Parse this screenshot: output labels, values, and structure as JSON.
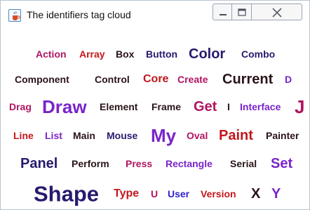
{
  "window": {
    "title": "The identifiers tag cloud"
  },
  "icons": {
    "app": "java-cup-icon",
    "minimize": "minimize-icon",
    "maximize": "maximize-icon",
    "close": "close-icon"
  },
  "colors": {
    "red": "#c4161c",
    "purple": "#7a24c9",
    "magenta": "#b01560",
    "navy": "#261b6e",
    "dark": "#2a1418",
    "blue": "#2f1fd0"
  },
  "tags": [
    {
      "text": "Action",
      "color": "#b01560",
      "weight": 1
    },
    {
      "text": "Array",
      "color": "#c4161c",
      "weight": 1
    },
    {
      "text": "Box",
      "color": "#2a1418",
      "weight": 1
    },
    {
      "text": "Button",
      "color": "#261b6e",
      "weight": 1
    },
    {
      "text": "Color",
      "color": "#261b6e",
      "weight": 3
    },
    {
      "text": "Combo",
      "color": "#261b6e",
      "weight": 1
    },
    {
      "text": "Component",
      "color": "#2a1418",
      "weight": 1
    },
    {
      "text": "Control",
      "color": "#2a1418",
      "weight": 1
    },
    {
      "text": "Core",
      "color": "#c4161c",
      "weight": 2
    },
    {
      "text": "Create",
      "color": "#b01560",
      "weight": 1
    },
    {
      "text": "Current",
      "color": "#2a1418",
      "weight": 3
    },
    {
      "text": "D",
      "color": "#7a24c9",
      "weight": 1
    },
    {
      "text": "Drag",
      "color": "#b01560",
      "weight": 1
    },
    {
      "text": "Draw",
      "color": "#7a24c9",
      "weight": 4
    },
    {
      "text": "Element",
      "color": "#2a1418",
      "weight": 1
    },
    {
      "text": "Frame",
      "color": "#2a1418",
      "weight": 1
    },
    {
      "text": "Get",
      "color": "#b01560",
      "weight": 3
    },
    {
      "text": "I",
      "color": "#2a1418",
      "weight": 1
    },
    {
      "text": "Interface",
      "color": "#7a24c9",
      "weight": 1
    },
    {
      "text": "J",
      "color": "#b01560",
      "weight": 4
    },
    {
      "text": "Line",
      "color": "#c4161c",
      "weight": 1
    },
    {
      "text": "List",
      "color": "#7a24c9",
      "weight": 1
    },
    {
      "text": "Main",
      "color": "#2a1418",
      "weight": 1
    },
    {
      "text": "Mouse",
      "color": "#261b6e",
      "weight": 1
    },
    {
      "text": "My",
      "color": "#7a24c9",
      "weight": 4
    },
    {
      "text": "Oval",
      "color": "#b01560",
      "weight": 1
    },
    {
      "text": "Paint",
      "color": "#c4161c",
      "weight": 3
    },
    {
      "text": "Painter",
      "color": "#2a1418",
      "weight": 1
    },
    {
      "text": "Panel",
      "color": "#261b6e",
      "weight": 3
    },
    {
      "text": "Perform",
      "color": "#2a1418",
      "weight": 1
    },
    {
      "text": "Press",
      "color": "#b01560",
      "weight": 1
    },
    {
      "text": "Rectangle",
      "color": "#7a24c9",
      "weight": 1
    },
    {
      "text": "Serial",
      "color": "#2a1418",
      "weight": 1
    },
    {
      "text": "Set",
      "color": "#7a24c9",
      "weight": 3
    },
    {
      "text": "Shape",
      "color": "#261b6e",
      "weight": 5
    },
    {
      "text": "Type",
      "color": "#c4161c",
      "weight": 2
    },
    {
      "text": "U",
      "color": "#b01560",
      "weight": 1
    },
    {
      "text": "User",
      "color": "#2f1fd0",
      "weight": 1
    },
    {
      "text": "Version",
      "color": "#c4161c",
      "weight": 1
    },
    {
      "text": "X",
      "color": "#2a1418",
      "weight": 3
    },
    {
      "text": "Y",
      "color": "#7a24c9",
      "weight": 3
    }
  ]
}
